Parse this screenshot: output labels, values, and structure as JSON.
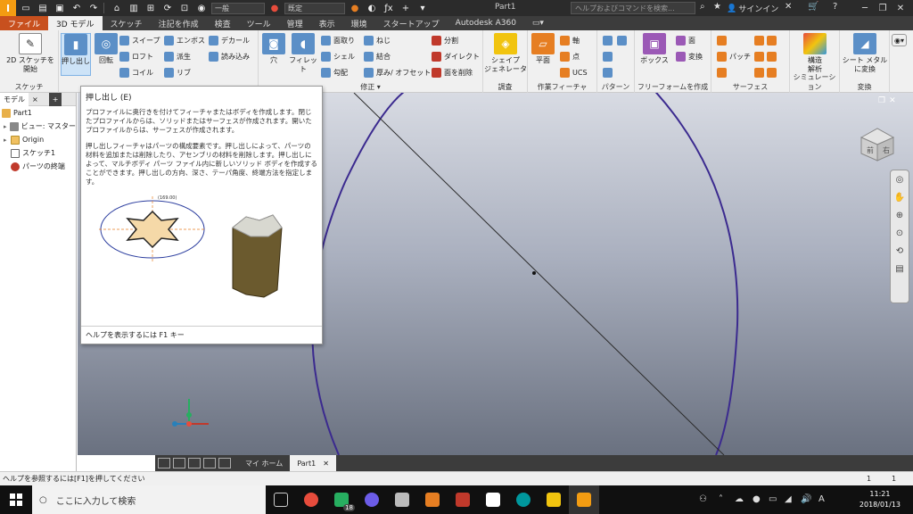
{
  "titlebar": {
    "app_logo": "I",
    "style_combo": "一般",
    "material_combo": "既定",
    "document_title": "Part1",
    "help_search_placeholder": "ヘルプおよびコマンドを検索...",
    "sign_in": "サインイン"
  },
  "ribbon_tabs": [
    "ファイル",
    "3D モデル",
    "スケッチ",
    "注記を作成",
    "検査",
    "ツール",
    "管理",
    "表示",
    "環境",
    "スタートアップ",
    "Autodesk A360"
  ],
  "ribbon": {
    "sketch": {
      "start_sketch": "2D スケッチを\n開始",
      "panel": "スケッチ"
    },
    "create": {
      "extrude": "押し出し",
      "revolve": "回転",
      "sweep": "スイープ",
      "loft": "ロフト",
      "coil": "コイル",
      "emboss": "エンボス",
      "derive": "派生",
      "rib": "リブ",
      "decal": "デカール",
      "import": "読み込み"
    },
    "modify": {
      "hole": "穴",
      "fillet": "フィレット",
      "chamfer": "面取り",
      "shell": "シェル",
      "draft": "勾配",
      "thread": "ねじ",
      "combine": "結合",
      "thicken": "厚み/ オフセット",
      "split": "分割",
      "direct": "ダイレクト",
      "delete_face": "面を削除",
      "panel": "修正 ▾"
    },
    "explore": {
      "shape_generator": "シェイプ\nジェネレータ",
      "panel": "調査"
    },
    "work_features": {
      "plane": "平面",
      "axis": "軸",
      "point": "点",
      "ucs": "UCS",
      "panel": "作業フィーチャ"
    },
    "pattern": {
      "panel": "パターン"
    },
    "freeform": {
      "box": "ボックス",
      "face": "面",
      "convert": "変換",
      "panel": "フリーフォームを作成"
    },
    "surface": {
      "patch": "パッチ",
      "panel": "サーフェス"
    },
    "simulation": {
      "stress": "構造\n解析",
      "panel": "シミュレーション"
    },
    "convert": {
      "sheet_metal": "シート メタル\nに変換",
      "panel": "変換"
    }
  },
  "browser": {
    "tabs": [
      "モデル",
      "×",
      "+"
    ],
    "items": [
      {
        "label": "Part1",
        "indent": 0
      },
      {
        "label": "ビュー: マスター",
        "indent": 1
      },
      {
        "label": "Origin",
        "indent": 1
      },
      {
        "label": "スケッチ1",
        "indent": 1
      },
      {
        "label": "パーツの終端",
        "indent": 1
      }
    ]
  },
  "tooltip": {
    "title": "押し出し (E)",
    "para1": "プロファイルに奥行きを付けてフィーチャまたはボディを作成します。閉じたプロファイルからは、ソリッドまたはサーフェスが作成されます。開いたプロファイルからは、サーフェスが作成されます。",
    "para2": "押し出しフィーチャはパーツの構成要素です。押し出しによって、パーツの材料を追加または削除したり、アセンブリの材料を削除します。押し出しによって、マルチボディ パーツ ファイル内に新しいソリッド ボディを作成することができます。押し出しの方向、深さ、テーパ角度、終端方法を指定します。",
    "dim_label": "(169.00)",
    "footer": "ヘルプを表示するには F1 キー"
  },
  "viewcube": {
    "front": "前",
    "right": "右"
  },
  "doc_tabs": [
    "マイ ホーム",
    "Part1"
  ],
  "statusbar": {
    "message": "ヘルプを参照するには[F1]を押してください",
    "count1": "1",
    "count2": "1"
  },
  "taskbar": {
    "search_placeholder": "ここに入力して検索",
    "badge": "18",
    "time": "11:21",
    "date": "2018/01/13",
    "ime": "A"
  }
}
